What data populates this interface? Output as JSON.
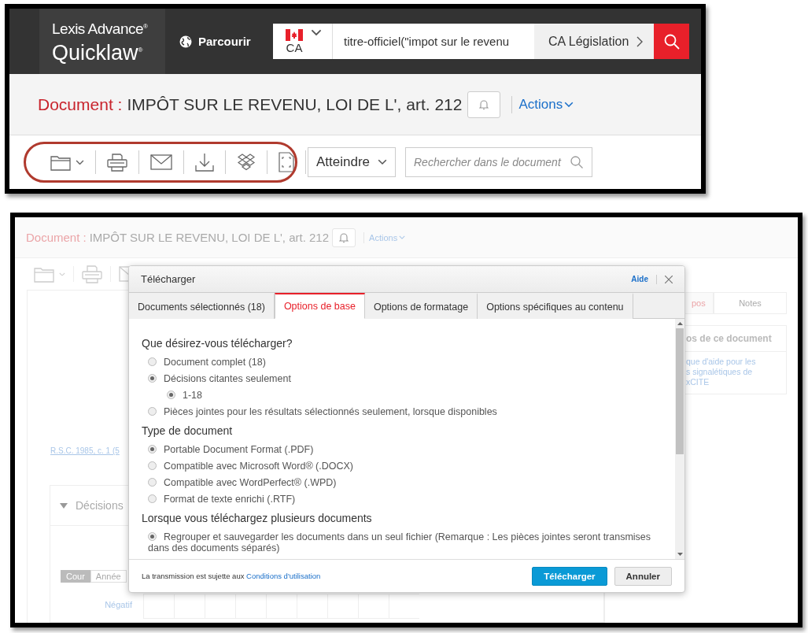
{
  "top_screenshot": {
    "logo": {
      "line_1": "Lexis Advance$^{®}$",
      "line_2": "Quicklaw$^{®}$"
    },
    "browse": "Parcourir",
    "search": {
      "country": "CA",
      "query": "titre-officiel(\"impot sur le revenu",
      "source": "CA Législation"
    },
    "title": {
      "label": "Document :",
      "text": "IMPÔT SUR LE REVENU, LOI DE L', art. 212",
      "actions": "Actions"
    },
    "toolbar": {
      "goto": "Atteindre",
      "search_placeholder": "Rechercher dans le document"
    }
  },
  "bottom_screenshot": {
    "title": {
      "label": "Document :",
      "text": "IMPÔT SUR LE REVENU, LOI DE L', art. 212",
      "actions": "Actions"
    },
    "background": {
      "citation_link": "R.S.C. 1985, c. 1 (5",
      "panel_title": "Décisions",
      "tabs": [
        {
          "label": "Cour",
          "selected": true
        },
        {
          "label": "Année",
          "selected": false
        }
      ],
      "row_label": "Négatif",
      "side_tabs": [
        {
          "label": "pos",
          "selected": true
        },
        {
          "label": "Notes",
          "selected": false
        }
      ],
      "side_box_title": "os de ce document",
      "side_box_lines": [
        "que d'aide pour les",
        "s signalétiques de",
        "xCITE"
      ]
    },
    "dialog": {
      "title": "Télécharger",
      "help": "Aide",
      "tabs": [
        {
          "label": "Documents sélectionnés (18)",
          "selected": false
        },
        {
          "label": "Options de base",
          "selected": true
        },
        {
          "label": "Options de formatage",
          "selected": false
        },
        {
          "label": "Options spécifiques au contenu",
          "selected": false
        }
      ],
      "sections": [
        {
          "heading": "Que désirez-vous télécharger?",
          "options": [
            {
              "label": "Document complet (18)",
              "selected": false
            },
            {
              "label": "Décisions citantes seulement",
              "selected": true,
              "children": [
                {
                  "label": "1-18",
                  "selected": true
                }
              ]
            },
            {
              "label": "Pièces jointes pour les résultats sélectionnés seulement, lorsque disponibles",
              "selected": false
            }
          ]
        },
        {
          "heading": "Type de document",
          "options": [
            {
              "label": "Portable Document Format (.PDF)",
              "selected": true
            },
            {
              "label": "Compatible avec Microsoft Word® (.DOCX)",
              "selected": false
            },
            {
              "label": "Compatible avec WordPerfect® (.WPD)",
              "selected": false
            },
            {
              "label": "Format de texte enrichi (.RTF)",
              "selected": false
            }
          ]
        },
        {
          "heading": "Lorsque vous téléchargez plusieurs documents",
          "options": [
            {
              "label": "Regrouper et sauvegarder les documents dans un seul fichier (Remarque : Les pièces jointes seront transmises dans des documents séparés)",
              "selected": true
            }
          ]
        }
      ],
      "footer_text": "La transmission est sujette aux",
      "footer_link": "Conditions d'utilisation",
      "buttons": [
        {
          "label": "Télécharger",
          "kind": "primary"
        },
        {
          "label": "Annuler",
          "kind": "secondary"
        }
      ]
    }
  }
}
